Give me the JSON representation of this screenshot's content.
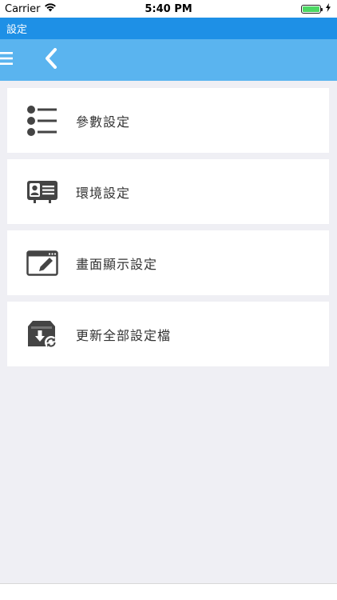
{
  "status_bar": {
    "carrier": "Carrier",
    "time": "5:40 PM",
    "battery_level": 1.0
  },
  "header": {
    "title": "設定"
  },
  "nav": {
    "menu_icon": "hamburger-menu-icon",
    "back_icon": "chevron-left-icon"
  },
  "settings_items": [
    {
      "label": "參數設定",
      "icon": "list-icon"
    },
    {
      "label": "環境設定",
      "icon": "id-card-icon"
    },
    {
      "label": "畫面顯示設定",
      "icon": "edit-window-icon"
    },
    {
      "label": "更新全部設定檔",
      "icon": "download-sync-icon"
    }
  ],
  "colors": {
    "title_strip": "#1e90e6",
    "nav_bar": "#5ab4ef",
    "background": "#efeff4",
    "icon": "#444444"
  }
}
